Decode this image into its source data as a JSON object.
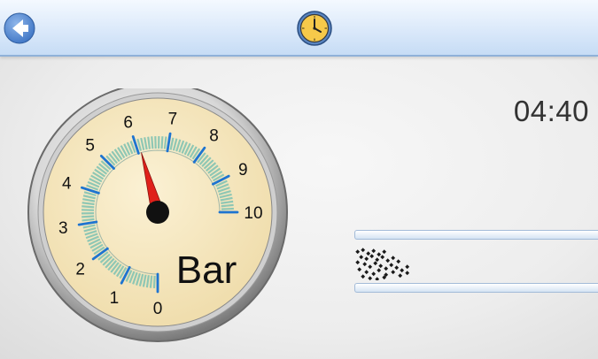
{
  "header": {
    "back_icon": "back-arrow-icon",
    "clock_icon": "clock-icon"
  },
  "time": "04:40",
  "gauge": {
    "unit": "Bar",
    "min": 0,
    "max": 10,
    "value": 6.1,
    "tick_labels": [
      "0",
      "1",
      "2",
      "3",
      "4",
      "5",
      "6",
      "7",
      "8",
      "9",
      "10"
    ]
  },
  "status": {
    "indicator_icon": "pattern-indicator-icon"
  },
  "colors": {
    "header_blue": "#c6dcf5",
    "gauge_face": "#f5e8c4",
    "tick_blue": "#1e74d0",
    "needle_red": "#e0201a",
    "scale_green": "#8fc7b4"
  }
}
